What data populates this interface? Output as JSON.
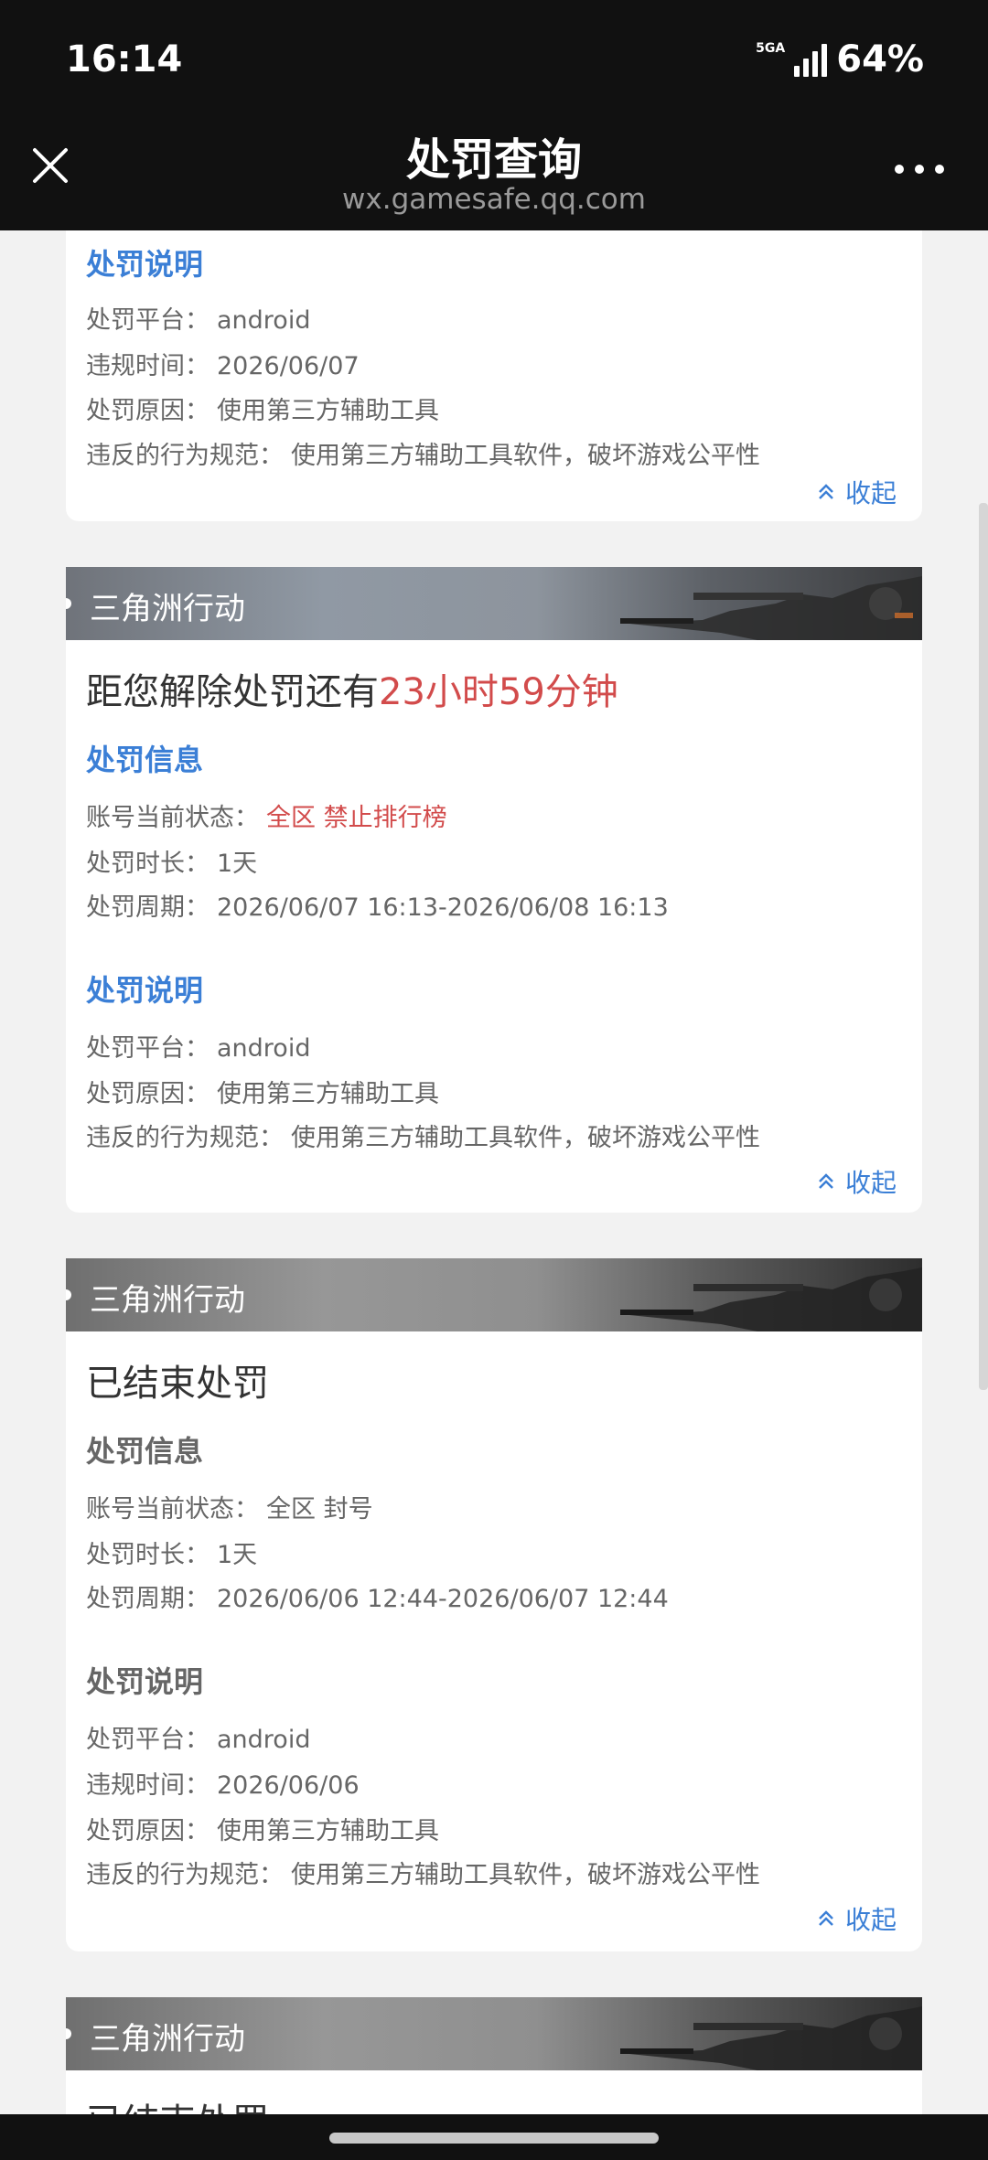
{
  "status_bar": {
    "time": "16:14",
    "network": "5GA",
    "battery": "64%"
  },
  "nav": {
    "title": "处罚查询",
    "url": "wx.gamesafe.qq.com"
  },
  "labels": {
    "penalty_info": "处罚信息",
    "penalty_desc": "处罚说明",
    "status": "账号当前状态：",
    "duration": "处罚时长：",
    "period": "处罚周期：",
    "platform": "处罚平台：",
    "violation_time": "违规时间：",
    "reason": "处罚原因：",
    "rule": "违反的行为规范：",
    "collapse": "收起",
    "countdown_prefix": "距您解除处罚还有",
    "ended": "已结束处罚"
  },
  "game_name": "三角洲行动",
  "cards": [
    {
      "platform": "android",
      "violation_time": "2026/06/07",
      "reason": "使用第三方辅助工具",
      "rule": "使用第三方辅助工具软件，破坏游戏公平性"
    },
    {
      "countdown": "23小时59分钟",
      "status": "全区 禁止排行榜",
      "duration": "1天",
      "period": "2026/06/07 16:13-2026/06/08 16:13",
      "platform": "android",
      "reason": "使用第三方辅助工具",
      "rule": "使用第三方辅助工具软件，破坏游戏公平性"
    },
    {
      "status": "全区 封号",
      "duration": "1天",
      "period": "2026/06/06 12:44-2026/06/07 12:44",
      "platform": "android",
      "violation_time": "2026/06/06",
      "reason": "使用第三方辅助工具",
      "rule": "使用第三方辅助工具软件，破坏游戏公平性"
    },
    {
      "partial_title": "已结束处罚"
    }
  ],
  "colors": {
    "accent": "#3b7fd6",
    "alert": "#d24b4b"
  }
}
